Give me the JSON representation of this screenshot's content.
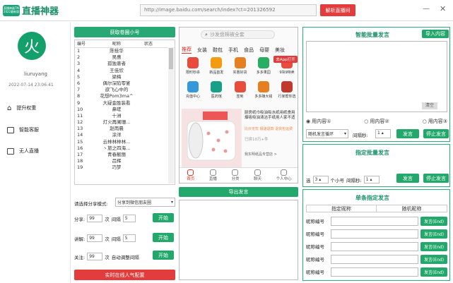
{
  "app": {
    "badge": "直播神器TM 2022最新版",
    "title": "直播神器",
    "url": "http://image.baidu.com/search/index?ct=201326592",
    "parse_btn": "解析直播间",
    "min": "—",
    "close": "✕"
  },
  "sidebar": {
    "avatar_char": "火",
    "username": "liuruyang",
    "datetime": "2022-07-14 23:06:41",
    "items": [
      {
        "label": "提升权重"
      },
      {
        "label": "智能客服"
      },
      {
        "label": "无人直播"
      }
    ]
  },
  "accounts": {
    "header": "获取卷圈小号",
    "col_num": "编号",
    "col_name": "昵称",
    "col_status": "状态",
    "rows": [
      {
        "num": "1",
        "name": "陈桂华"
      },
      {
        "num": "2",
        "name": "吴惠"
      },
      {
        "num": "3",
        "name": "孤独患者"
      },
      {
        "num": "4",
        "name": "王佳欣"
      },
      {
        "num": "5",
        "name": "梁梅"
      },
      {
        "num": "6",
        "name": "偶尔深陷零宴"
      },
      {
        "num": "7",
        "name": "欲飞心中的"
      },
      {
        "num": "8",
        "name": "花想Pom3ma^"
      },
      {
        "num": "9",
        "name": "大疑金胜装看"
      },
      {
        "num": "10",
        "name": "鼻嗟"
      },
      {
        "num": "11",
        "name": "十洲"
      },
      {
        "num": "12",
        "name": "灯火再阑珊..."
      },
      {
        "num": "13",
        "name": "赵雨晨"
      },
      {
        "num": "14",
        "name": "涂洋"
      },
      {
        "num": "15",
        "name": "云林林林林..."
      },
      {
        "num": "16",
        "name": "丶旅之四海..."
      },
      {
        "num": "17",
        "name": "青春靓丽"
      },
      {
        "num": "18",
        "name": "吕辉"
      },
      {
        "num": "19",
        "name": "巧梦"
      }
    ],
    "share_label": "请选择分享模式:",
    "share_value": "分享到微信朋友圈",
    "share": {
      "label": "分享:",
      "count": "99",
      "unit": "次",
      "interval_label": "间隔",
      "interval": "5",
      "btn": "开始"
    },
    "comment": {
      "label": "讲解:",
      "count": "99",
      "unit": "次",
      "interval_label": "间隔",
      "interval": "5",
      "btn": "开始"
    },
    "follow": {
      "label": "关注:",
      "count": "99",
      "unit": "次",
      "interval_label": "自动调整间隔",
      "btn": "开始"
    },
    "popularity_btn": "实时在线人气配置"
  },
  "browser": {
    "search_placeholder": "沙发盘棉被全套",
    "tabs": [
      "推荐",
      "女装",
      "鞋包",
      "手机",
      "食品",
      "母婴",
      "美妆"
    ],
    "icons1": [
      {
        "label": "限时秒杀",
        "color": "#e84b3c"
      },
      {
        "label": "新品首发",
        "color": "#f39c12"
      },
      {
        "label": "实惠好货",
        "color": "#e67e22"
      },
      {
        "label": "多多果园",
        "color": "#27ae60"
      },
      {
        "label": "9块9特卖",
        "color": "#e74c3c"
      }
    ],
    "icons2": [
      {
        "label": "充值中心",
        "color": "#3498db"
      },
      {
        "label": "医药馆",
        "color": "#16a085"
      },
      {
        "label": "签到",
        "color": "#e74c3c"
      },
      {
        "label": "多多赚大钱",
        "color": "#e67e22"
      },
      {
        "label": "行家帮你选",
        "color": "#c0392b"
      }
    ],
    "promo_btn": "去App打开",
    "product_desc": "厨房纸巾吸油吸水纸用纸食用烟吸吸油清洁手纸用人家不适",
    "product_sub": "比价无忧 极速退款 退货包运费",
    "price": "已拼10万+件",
    "shop": "我东明纸品专营店 >",
    "bottom_nav": [
      "首页",
      "直播",
      "分类",
      "聊天",
      "个人中心"
    ],
    "export_btn": "导出发言"
  },
  "smart": {
    "title": "智能批量发言",
    "import_btn": "导入内容",
    "clear_btn": "清空",
    "radios": [
      "用内容①",
      "用内容②",
      "用内容③"
    ],
    "mode": "随机发言循环",
    "interval_label": "间隔秒:",
    "interval": "1",
    "send_btn": "发言",
    "stop_btn": "停止发言"
  },
  "spec": {
    "title": "指定批量发言",
    "prefix": "选",
    "count": "3",
    "unit": "个小号",
    "interval_label": "间隔秒:",
    "interval": "1",
    "send_btn": "发言",
    "stop_btn": "停止发言"
  },
  "single": {
    "title": "单条指定发言",
    "col1": "指定昵称",
    "col2": "随机昵称",
    "rows": [
      {
        "label": "昵称编号",
        "btn": "发言(End)"
      },
      {
        "label": "昵称编号",
        "btn": "发言(End)"
      },
      {
        "label": "昵称编号",
        "btn": "发言(End)"
      },
      {
        "label": "昵称编号",
        "btn": "发言(End)"
      },
      {
        "label": "昵称编号",
        "btn": "发言(End)"
      }
    ]
  }
}
